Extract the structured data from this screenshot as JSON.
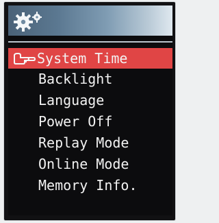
{
  "header": {
    "icon": "gear-icon"
  },
  "menu": {
    "pointer_icon": "hand-pointer-icon",
    "items": [
      {
        "label": "System Time",
        "selected": true
      },
      {
        "label": "Backlight",
        "selected": false
      },
      {
        "label": "Language",
        "selected": false
      },
      {
        "label": "Power Off",
        "selected": false
      },
      {
        "label": "Replay Mode",
        "selected": false
      },
      {
        "label": "Online Mode",
        "selected": false
      },
      {
        "label": "Memory Info.",
        "selected": false
      }
    ]
  },
  "colors": {
    "selection": "#e04545",
    "text": "#f2f2f2",
    "screen_background": "#0c0c0e",
    "header_gradient_start": "#4a6278",
    "header_gradient_end": "#dfe8ef"
  }
}
